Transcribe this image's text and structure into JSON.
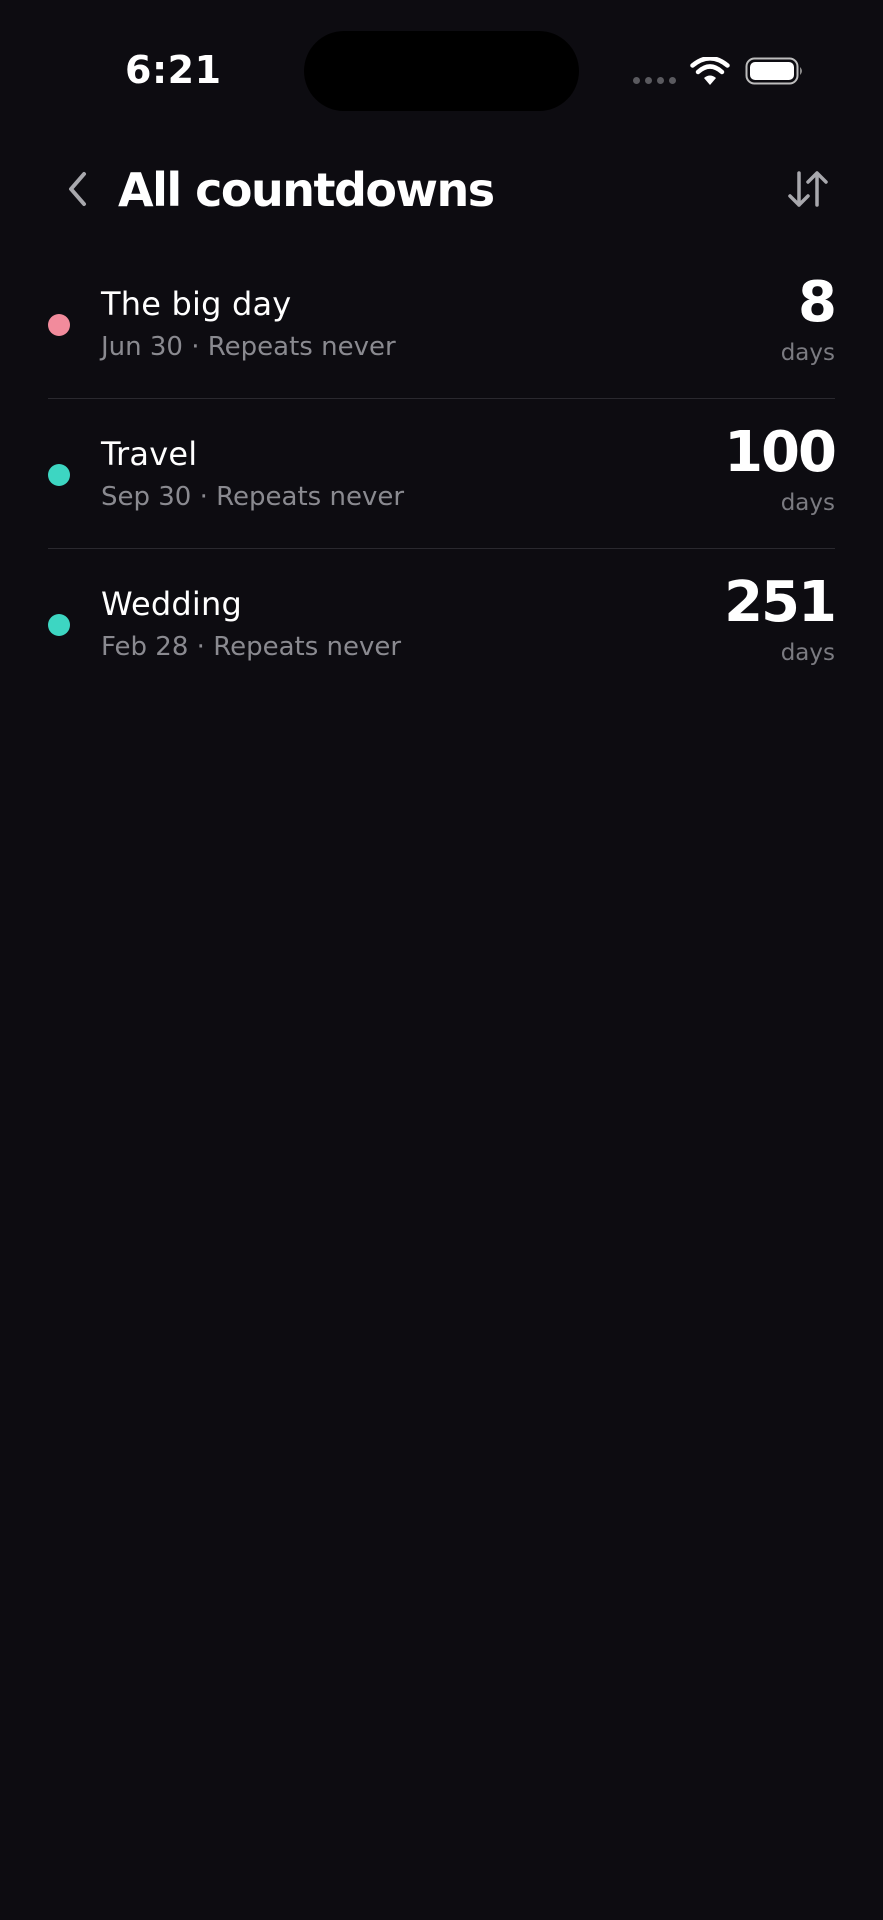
{
  "status_bar": {
    "time": "6:21",
    "icons": [
      "signal-dots-icon",
      "wifi-icon",
      "battery-icon"
    ]
  },
  "header": {
    "title": "All countdowns",
    "back_icon": "chevron-left-icon",
    "sort_icon": "sort-arrows-icon"
  },
  "countdowns": [
    {
      "title": "The big day",
      "date": "Jun 30",
      "separator": "·",
      "repeat": "Repeats never",
      "count": "8",
      "unit": "days",
      "color": "#f28b9c"
    },
    {
      "title": "Travel",
      "date": "Sep 30",
      "separator": "·",
      "repeat": "Repeats never",
      "count": "100",
      "unit": "days",
      "color": "#3dd6c2"
    },
    {
      "title": "Wedding",
      "date": "Feb 28",
      "separator": "·",
      "repeat": "Repeats never",
      "count": "251",
      "unit": "days",
      "color": "#3dd6c2"
    }
  ]
}
